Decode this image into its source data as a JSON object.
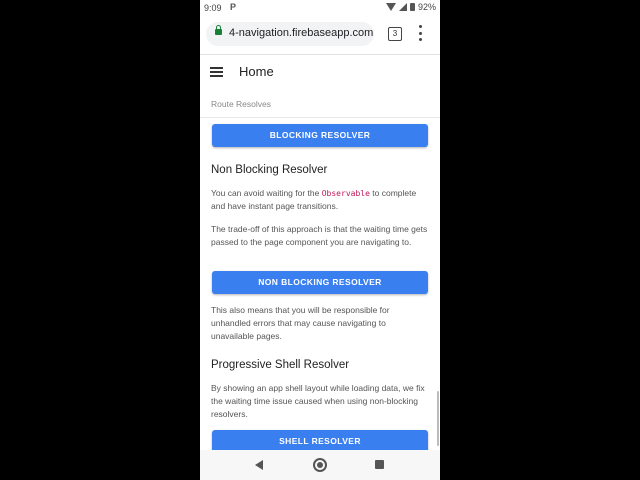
{
  "status_bar": {
    "time": "9:09",
    "notification_icon": "P",
    "battery": "92%"
  },
  "browser": {
    "url": "4-navigation.firebaseapp.com",
    "tab_count": "3"
  },
  "app_header": {
    "title": "Home"
  },
  "content": {
    "caption": "Route Resolves",
    "blocking_button": "BLOCKING RESOLVER",
    "non_blocking": {
      "heading": "Non Blocking Resolver",
      "p1_before": "You can avoid waiting for the ",
      "p1_code": "Observable",
      "p1_after": " to complete and have instant page transitions.",
      "p2": "The trade-off of this approach is that the waiting time gets passed to the page component you are navigating to.",
      "button": "NON BLOCKING RESOLVER",
      "p3": "This also means that you will be responsible for unhandled errors that may cause navigating to unavailable pages."
    },
    "progressive": {
      "heading": "Progressive Shell Resolver",
      "p1": "By showing an app shell layout while loading data, we fix the waiting time issue caused when using non-blocking resolvers.",
      "button": "SHELL RESOLVER"
    }
  },
  "icons": {
    "lock": "lock-icon",
    "menu": "menu-icon",
    "overflow": "more-vert-icon",
    "back": "back-icon",
    "home": "home-icon",
    "recents": "recents-icon"
  },
  "colors": {
    "button": "#3a7ff0",
    "code": "#c2185b",
    "lock": "#188038"
  }
}
